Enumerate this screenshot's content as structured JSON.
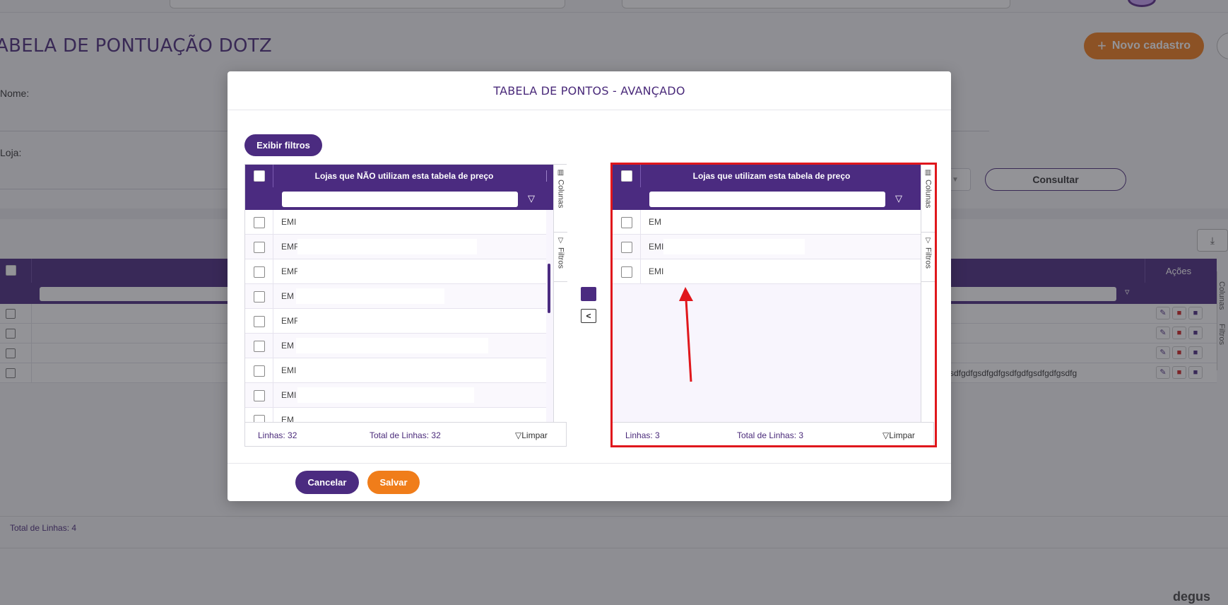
{
  "background": {
    "page_title": "ABELA DE PONTUAÇÃO DOTZ",
    "new_button_label": "Novo cadastro",
    "new_button_icon": "plus-icon",
    "nome_label": "Nome:",
    "loja_label": "Loja:",
    "consultar_label": "Consultar",
    "acoes_label": "Ações",
    "row_text": "sdfgdfgsdfgdfgsdfgdfgsdfgdfgsdfg",
    "total_linhas": "Total de Linhas: 4",
    "logo_text": "degus",
    "side_tabs": [
      "Colunas",
      "Filtros"
    ]
  },
  "modal": {
    "title": "TABELA DE PONTOS - AVANÇADO",
    "exibir_filtros": "Exibir filtros",
    "left_grid": {
      "header": "Lojas que NÃO utilizam esta tabela de preço",
      "rows": [
        "EMI",
        "EMF",
        "EMF",
        "EM",
        "EMF",
        "EM",
        "EMI",
        "EMI",
        "EM"
      ],
      "footer_linhas": "Linhas: 32",
      "footer_total": "Total de Linhas: 32",
      "footer_limpar": "Limpar",
      "side_tabs": [
        "Colunas",
        "Filtros"
      ]
    },
    "right_grid": {
      "header": "Lojas que utilizam esta tabela de preço",
      "rows": [
        "EM",
        "EMI",
        "EMI"
      ],
      "footer_linhas": "Linhas: 3",
      "footer_total": "Total de Linhas: 3",
      "footer_limpar": "Limpar",
      "side_tabs": [
        "Colunas",
        "Filtros"
      ]
    },
    "move_right_label": ">",
    "move_left_label": "<",
    "cancel_label": "Cancelar",
    "save_label": "Salvar"
  },
  "colors": {
    "primary_purple": "#4b2b80",
    "accent_orange": "#f07d1a",
    "highlight_red": "#e0171c"
  }
}
